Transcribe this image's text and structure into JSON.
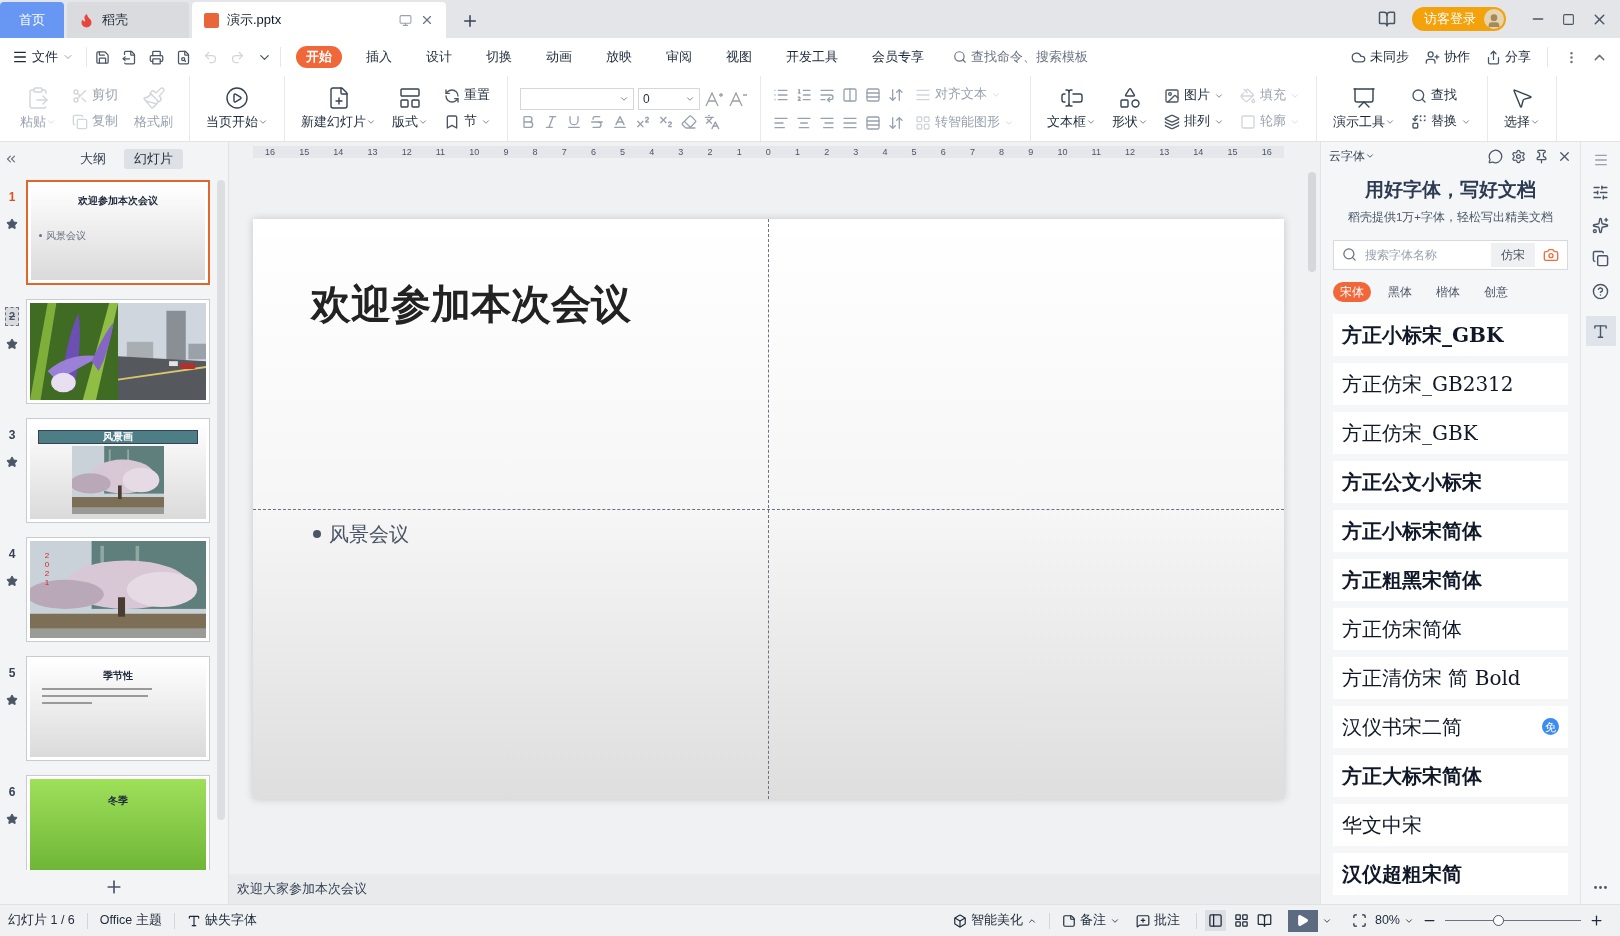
{
  "tabbar": {
    "tabs": [
      {
        "label": "首页",
        "kind": "home",
        "selected": false
      },
      {
        "label": "稻壳",
        "kind": "docer",
        "selected": false
      },
      {
        "label": "演示.pptx",
        "kind": "doc",
        "selected": true
      }
    ],
    "login": "访客登录"
  },
  "menu": {
    "file": "文件",
    "tabs": [
      {
        "label": "开始",
        "selected": true
      },
      {
        "label": "插入",
        "selected": false
      },
      {
        "label": "设计",
        "selected": false
      },
      {
        "label": "切换",
        "selected": false
      },
      {
        "label": "动画",
        "selected": false
      },
      {
        "label": "放映",
        "selected": false
      },
      {
        "label": "审阅",
        "selected": false
      },
      {
        "label": "视图",
        "selected": false
      },
      {
        "label": "开发工具",
        "selected": false
      },
      {
        "label": "会员专享",
        "selected": false
      }
    ],
    "search": {
      "placeholder": "查找命令、搜索模板"
    },
    "actions": [
      "未同步",
      "协作",
      "分享"
    ]
  },
  "ribbon": {
    "groups": [
      {
        "kind": "tools",
        "columns": [
          {
            "kind": "large",
            "label": "粘贴",
            "disabled": true,
            "dropdown": true
          },
          {
            "kind": "stack",
            "items": [
              {
                "label": "剪切",
                "disabled": true,
                "dropdown": false
              },
              {
                "label": "复制",
                "disabled": true,
                "dropdown": false
              }
            ]
          },
          {
            "kind": "large",
            "label": "格式刷",
            "disabled": true,
            "dropdown": false
          }
        ]
      },
      {
        "kind": "tools",
        "columns": [
          {
            "kind": "large",
            "label": "当页开始",
            "disabled": false,
            "dropdown": true
          }
        ]
      },
      {
        "kind": "tools",
        "columns": [
          {
            "kind": "large",
            "label": "新建幻灯片",
            "disabled": false,
            "dropdown": true
          },
          {
            "kind": "large",
            "label": "版式",
            "disabled": false,
            "dropdown": true
          },
          {
            "kind": "stack",
            "items": [
              {
                "label": "重置",
                "disabled": false,
                "dropdown": false
              },
              {
                "label": "节",
                "disabled": false,
                "dropdown": true
              }
            ]
          }
        ]
      },
      {
        "kind": "font",
        "size": "0"
      },
      {
        "kind": "paragraph",
        "items": [
          {
            "label": "对齐文本",
            "disabled": true,
            "dropdown": true
          },
          {
            "label": "转智能图形",
            "disabled": true,
            "dropdown": true
          }
        ]
      },
      {
        "kind": "tools",
        "columns": [
          {
            "kind": "large",
            "label": "文本框",
            "disabled": false,
            "dropdown": true
          },
          {
            "kind": "large",
            "label": "形状",
            "disabled": false,
            "dropdown": true
          },
          {
            "kind": "stack",
            "items": [
              {
                "label": "图片",
                "disabled": false,
                "dropdown": true
              },
              {
                "label": "排列",
                "disabled": false,
                "dropdown": true
              }
            ]
          },
          {
            "kind": "stack",
            "items": [
              {
                "label": "填充",
                "disabled": true,
                "dropdown": true
              },
              {
                "label": "轮廓",
                "disabled": true,
                "dropdown": true
              }
            ]
          }
        ]
      },
      {
        "kind": "tools",
        "columns": [
          {
            "kind": "large",
            "label": "演示工具",
            "disabled": false,
            "dropdown": true
          },
          {
            "kind": "stack",
            "items": [
              {
                "label": "查找",
                "disabled": false,
                "dropdown": false
              },
              {
                "label": "替换",
                "disabled": false,
                "dropdown": true
              }
            ]
          }
        ]
      },
      {
        "kind": "tools",
        "columns": [
          {
            "kind": "large",
            "label": "选择",
            "disabled": false,
            "dropdown": true
          }
        ]
      }
    ]
  },
  "left_panel": {
    "tabs": [
      {
        "label": "大纲",
        "selected": false
      },
      {
        "label": "幻灯片",
        "selected": true
      }
    ],
    "slides": [
      {
        "number": "1",
        "kind": "title",
        "selected": true,
        "hidden": false,
        "title": "欢迎参加本次会议",
        "bullet": "风景会议"
      },
      {
        "number": "2",
        "kind": "photos",
        "selected": false,
        "hidden": true
      },
      {
        "number": "3",
        "kind": "banner",
        "selected": false,
        "hidden": false,
        "title": "风景画"
      },
      {
        "number": "4",
        "selected": false,
        "hidden": false,
        "caption": "2021"
      },
      {
        "number": "5",
        "kind": "text",
        "selected": false,
        "hidden": false,
        "title": "季节性"
      },
      {
        "number": "6",
        "kind": "green",
        "selected": false,
        "hidden": false,
        "title": "冬季"
      }
    ]
  },
  "ruler": [
    "16",
    "15",
    "14",
    "13",
    "12",
    "11",
    "10",
    "9",
    "8",
    "7",
    "6",
    "5",
    "4",
    "3",
    "2",
    "1",
    "0",
    "1",
    "2",
    "3",
    "4",
    "5",
    "6",
    "7",
    "8",
    "9",
    "10",
    "11",
    "12",
    "13",
    "14",
    "15",
    "16"
  ],
  "slide": {
    "title": "欢迎参加本次会议",
    "bullet": "风景会议"
  },
  "notes": "欢迎大家参加本次会议",
  "font_panel": {
    "header": "云字体",
    "heading": "用好字体，写好文档",
    "subtitle": "稻壳提供1万+字体，轻松写出精美文档",
    "search": {
      "placeholder": "搜索字体名称",
      "button": "仿宋"
    },
    "categories": [
      {
        "label": "宋体",
        "selected": true
      },
      {
        "label": "黑体",
        "selected": false
      },
      {
        "label": "楷体",
        "selected": false
      },
      {
        "label": "创意",
        "selected": false
      }
    ],
    "fonts": [
      {
        "name": "方正小标宋_GBK",
        "bold": true
      },
      {
        "name": "方正仿宋_GB2312",
        "bold": false
      },
      {
        "name": "方正仿宋_GBK",
        "bold": false
      },
      {
        "name": "方正公文小标宋",
        "bold": true
      },
      {
        "name": "方正小标宋简体",
        "bold": true
      },
      {
        "name": "方正粗黑宋简体",
        "bold": true
      },
      {
        "name": "方正仿宋简体",
        "bold": false
      },
      {
        "name": "方正清仿宋 简 Bold",
        "bold": false
      },
      {
        "name": "汉仪书宋二简",
        "bold": false,
        "badge": "免"
      },
      {
        "name": "方正大标宋简体",
        "bold": true
      },
      {
        "name": "华文中宋",
        "bold": false
      },
      {
        "name": "汉仪超粗宋简",
        "bold": true
      }
    ]
  },
  "status_bar": {
    "slide": "幻灯片 1 / 6",
    "theme": "Office 主题",
    "missing_fonts": "缺失字体",
    "beautify": "智能美化",
    "notes": "备注",
    "comments": "批注",
    "zoom": {
      "value": "80%",
      "level": 0.39
    }
  }
}
